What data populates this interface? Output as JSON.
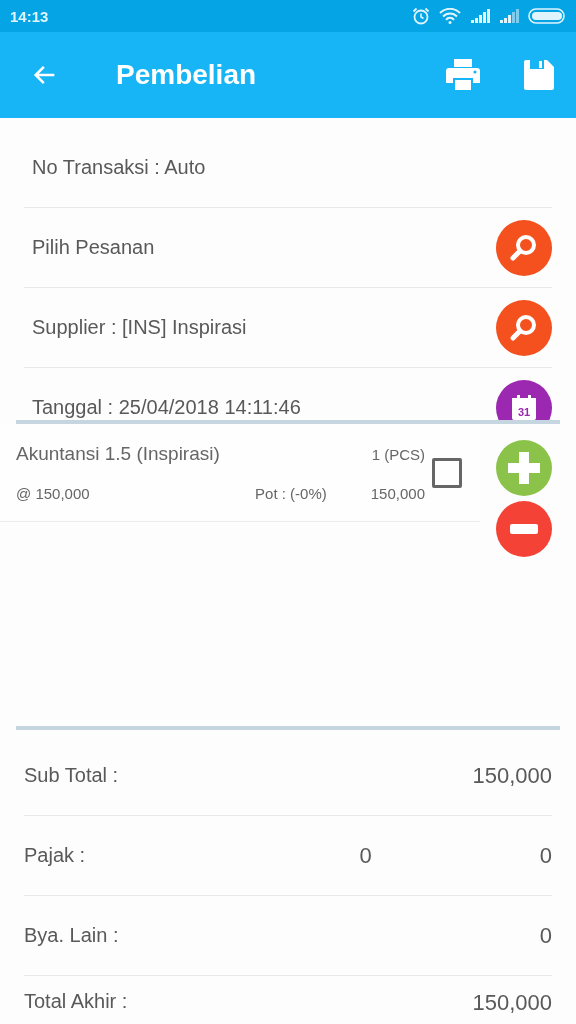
{
  "status_bar": {
    "time": "14:13"
  },
  "toolbar": {
    "title": "Pembelian"
  },
  "form_fields": [
    {
      "label": "No Transaksi : Auto"
    },
    {
      "label": "Pilih Pesanan",
      "kind": "search"
    },
    {
      "label": "Supplier : [INS] Inspirasi",
      "kind": "search"
    },
    {
      "label": "Tanggal : 25/04/2018 14:11:46",
      "kind": "calendar",
      "calendar_day": "31"
    }
  ],
  "items": [
    {
      "name": "Akuntansi 1.5 (Inspirasi)",
      "quantity": "1 (PCS)",
      "price": "@ 150,000",
      "discount": "Pot : (-0%)",
      "total": "150,000",
      "checked": false
    }
  ],
  "summary": [
    {
      "label": "Sub Total :",
      "value": "150,000"
    },
    {
      "label": "Pajak :",
      "rate": "0",
      "value": "0"
    },
    {
      "label": "Bya. Lain :",
      "value": "0"
    },
    {
      "label": "Total Akhir :",
      "value": "150,000"
    }
  ]
}
